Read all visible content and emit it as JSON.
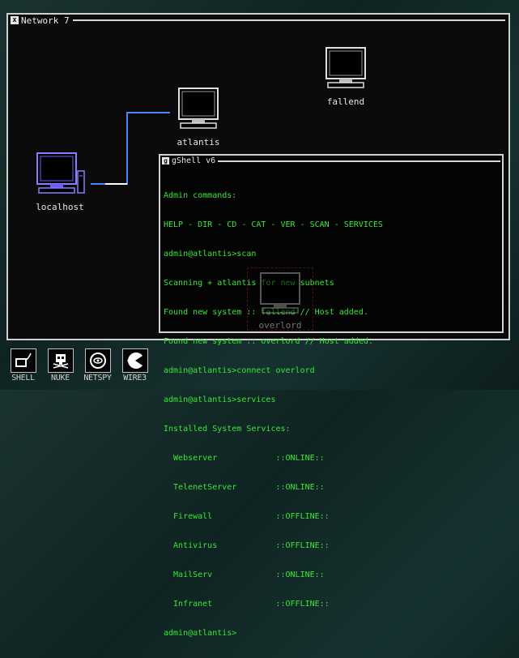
{
  "network_window": {
    "title": "Network 7",
    "close_glyph": "x"
  },
  "nodes": {
    "localhost": {
      "label": "localhost"
    },
    "atlantis": {
      "label": "atlantis"
    },
    "fallend": {
      "label": "fallend"
    },
    "overlord": {
      "label": "overlord"
    }
  },
  "colors": {
    "link_blue": "#4a86ff",
    "shell_text": "#39e639",
    "localhost_accent": "#7a6cff"
  },
  "shell": {
    "title": "gShell v6",
    "close_glyph": "g",
    "lines": [
      "Admin commands:",
      "HELP - DIR - CD - CAT - VER - SCAN - SERVICES",
      "admin@atlantis>scan",
      "Scanning + atlantis for new subnets",
      "Found new system :: fallend // Host added.",
      "Found new system :: overlord // Host added.",
      "admin@atlantis>connect overlord",
      "admin@atlantis>services",
      "Installed System Services:",
      "  Webserver            ::ONLINE::",
      "  TelenetServer        ::ONLINE::",
      "  Firewall             ::OFFLINE::",
      "  Antivirus            ::OFFLINE::",
      "  MailServ             ::ONLINE::",
      "  Infranet             ::OFFLINE::",
      "admin@atlantis>"
    ]
  },
  "dock": [
    {
      "label": "SHELL",
      "icon": "shell-icon"
    },
    {
      "label": "NUKE",
      "icon": "nuke-icon"
    },
    {
      "label": "NETSPY",
      "icon": "netspy-icon"
    },
    {
      "label": "WIRE3",
      "icon": "wire-icon"
    }
  ]
}
